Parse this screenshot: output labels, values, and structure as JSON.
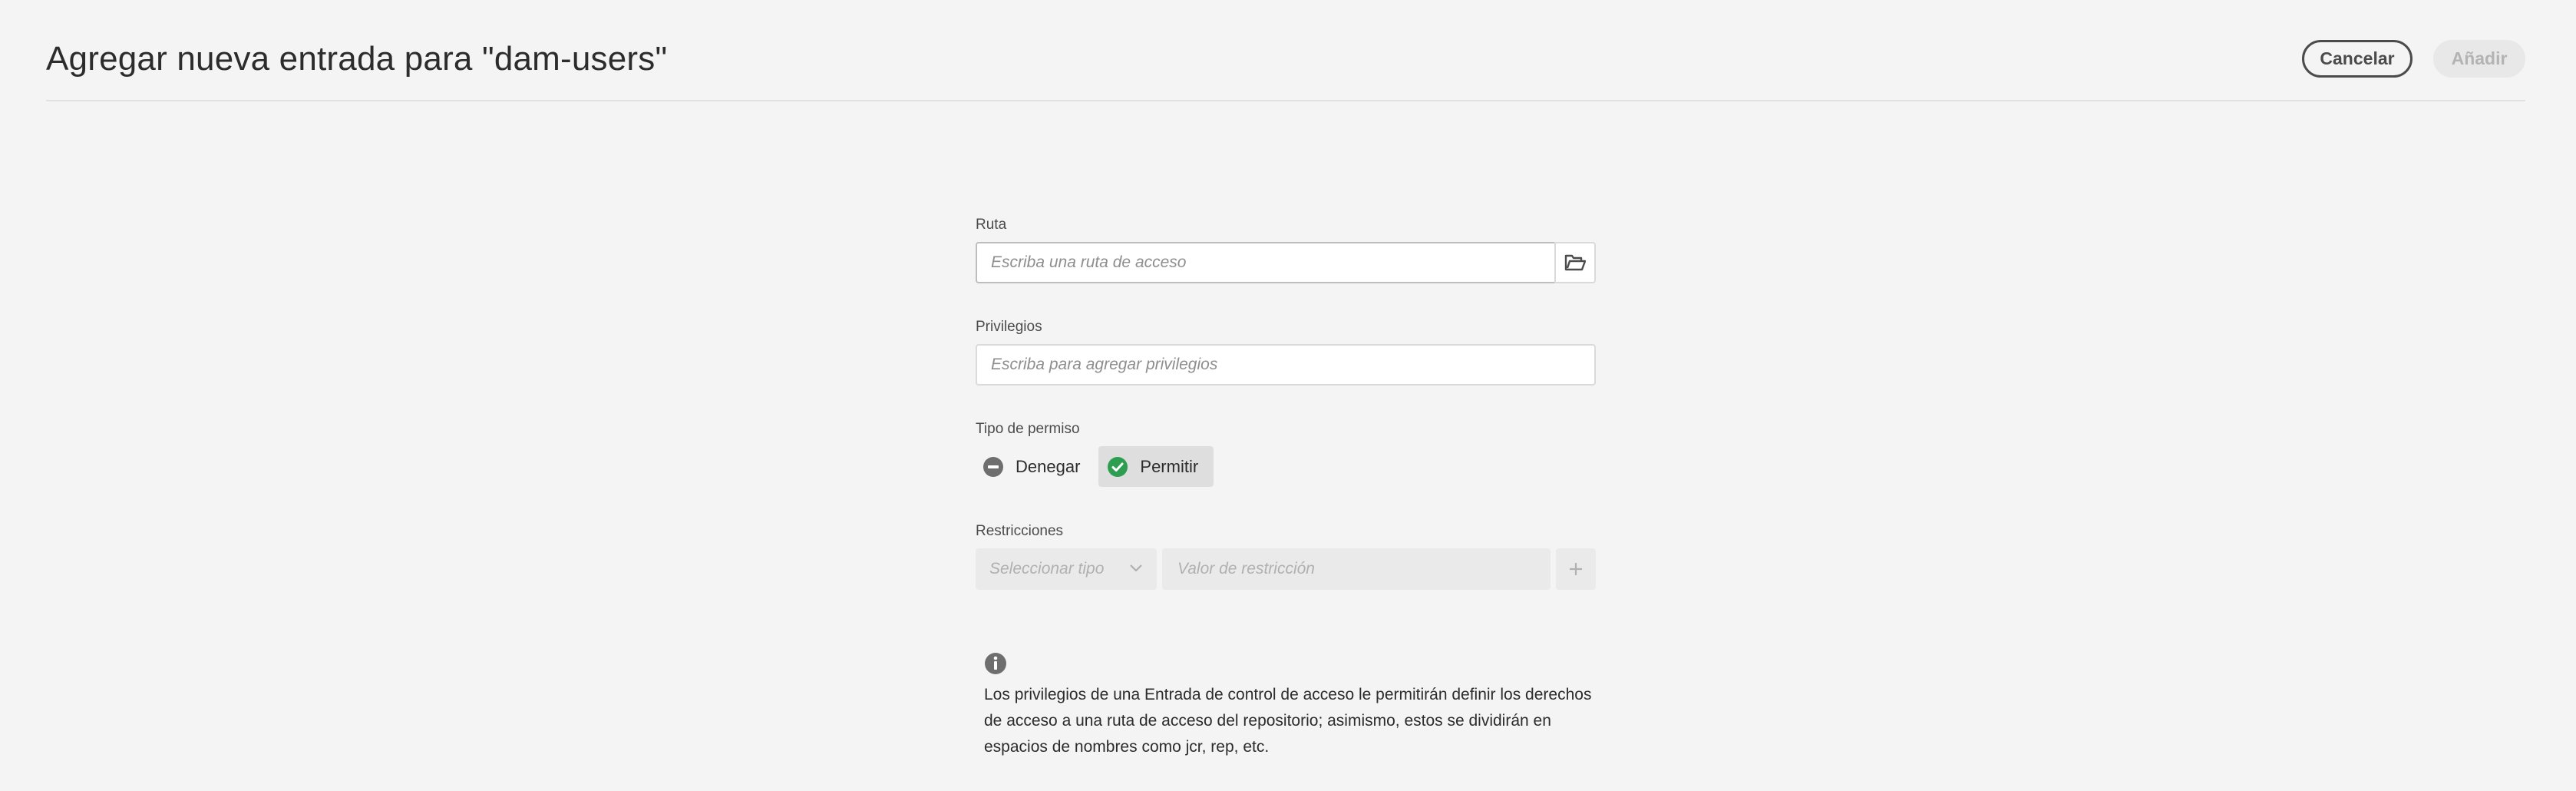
{
  "header": {
    "title": "Agregar nueva entrada para \"dam-users\"",
    "cancel_label": "Cancelar",
    "add_label": "Añadir"
  },
  "form": {
    "ruta": {
      "label": "Ruta",
      "placeholder": "Escriba una ruta de acceso",
      "browse_icon": "folder-icon"
    },
    "privilegios": {
      "label": "Privilegios",
      "placeholder": "Escriba para agregar privilegios"
    },
    "tipo_permiso": {
      "label": "Tipo de permiso",
      "options": [
        {
          "label": "Denegar",
          "icon": "minus-circle-icon",
          "selected": false
        },
        {
          "label": "Permitir",
          "icon": "check-circle-icon",
          "selected": true
        }
      ]
    },
    "restricciones": {
      "label": "Restricciones",
      "type_placeholder": "Seleccionar tipo",
      "value_placeholder": "Valor de restricción",
      "add_icon": "plus-icon"
    }
  },
  "info": {
    "icon": "info-icon",
    "text": "Los privilegios de una Entrada de control de acceso le permitirán definir los derechos de acceso a una ruta de acceso del repositorio; asimismo, estos se dividirán en espacios de nombres como jcr, rep, etc."
  },
  "colors": {
    "background": "#f4f4f4",
    "allow_green": "#2d9d4f",
    "deny_gray": "#6e6e6e",
    "disabled_button": "#e8e8e8"
  }
}
